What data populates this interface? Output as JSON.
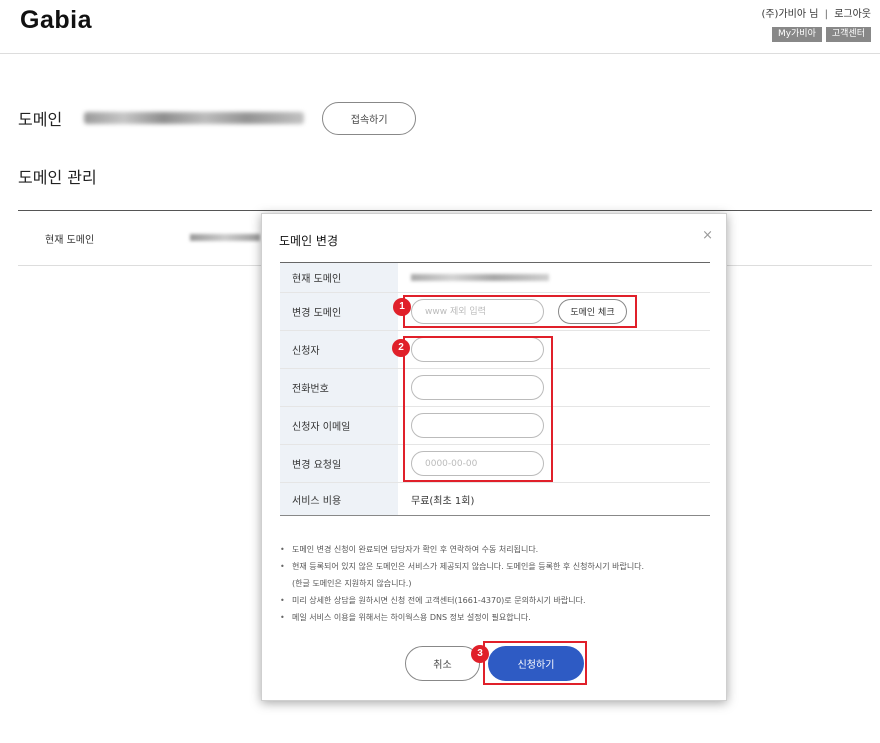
{
  "header": {
    "logo": "Gabia",
    "user_name": "(주)가비아 님",
    "separator": "|",
    "logout": "로그아웃",
    "my_gabia": "My가비아",
    "customer_center": "고객센터"
  },
  "domain_section": {
    "label": "도메인",
    "connect_button": "접속하기"
  },
  "manage_section": {
    "title": "도메인 관리",
    "current_label": "현재 도메인"
  },
  "modal": {
    "title": "도메인 변경",
    "close_icon": "×",
    "rows": {
      "current_domain": {
        "label": "현재 도메인"
      },
      "new_domain": {
        "label": "변경 도메인",
        "placeholder": "www 제외 입력",
        "check_button": "도메인 체크"
      },
      "applicant": {
        "label": "신청자",
        "value": ""
      },
      "phone": {
        "label": "전화번호",
        "value": ""
      },
      "email": {
        "label": "신청자 이메일",
        "value": ""
      },
      "request_date": {
        "label": "변경 요청일",
        "placeholder": "0000-00-00"
      },
      "fee": {
        "label": "서비스 비용",
        "value": "무료(최초 1회)"
      }
    },
    "notes": [
      "도메인 변경 신청이 완료되면 담당자가 확인 후 연락하여 수동 처리됩니다.",
      "현재 등록되어 있지 않은 도메인은 서비스가 제공되지 않습니다. 도메인을 등록한 후 신청하시기 바랍니다.",
      "(한글 도메인은 지원하지 않습니다.)",
      "미리 상세한 상담을 원하시면 신청 전에 고객센터(1661-4370)로 문의하시기 바랍니다.",
      "메일 서비스 이용을 위해서는 하이웍스용 DNS 정보 설정이 필요합니다."
    ],
    "cancel_button": "취소",
    "submit_button": "신청하기"
  },
  "annotations": {
    "step1": "1",
    "step2": "2",
    "step3": "3",
    "color": "#e0202a"
  },
  "colors": {
    "primary": "#2e5bc4",
    "header_button": "#888888",
    "table_header_bg": "#eef2f7"
  }
}
